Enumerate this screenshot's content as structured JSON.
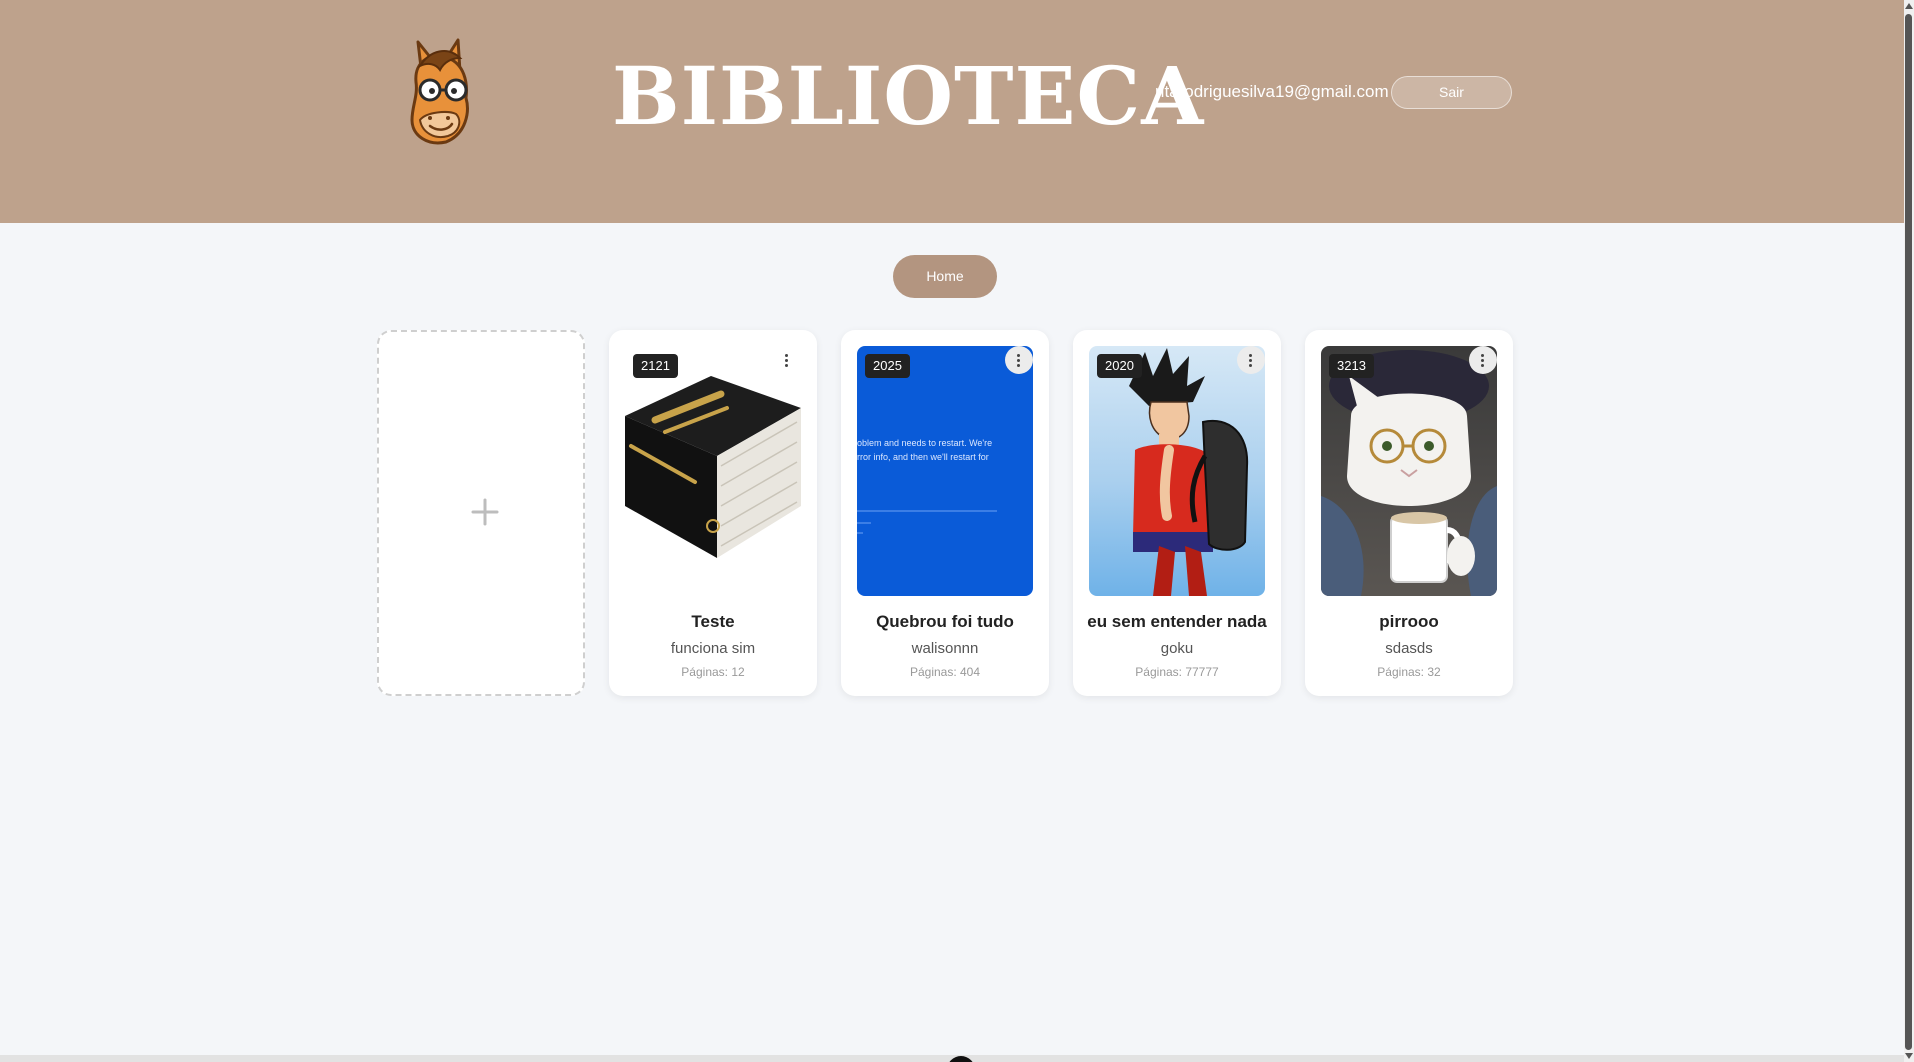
{
  "header": {
    "title": "BIBLIOTECA",
    "user_email": "ritarodriguesilva19@gmail.com",
    "logout_label": "Sair",
    "logo_icon": "horse-with-glasses-icon"
  },
  "nav": {
    "home_label": "Home"
  },
  "add_book": {
    "icon": "plus-icon"
  },
  "books": [
    {
      "year": "2121",
      "title": "Teste",
      "author": "funciona sim",
      "pages": "Páginas: 12",
      "cover": "black bible book cover"
    },
    {
      "year": "2025",
      "title": "Quebrou foi tudo",
      "author": "walisonnn",
      "pages": "Páginas: 404",
      "cover": "blue error screen",
      "cover_text_1": "oblem and needs to restart. We're",
      "cover_text_2": "rror info, and then we'll restart for"
    },
    {
      "year": "2020",
      "title": "eu sem entender nada",
      "author": "goku",
      "pages": "Páginas: 77777",
      "cover": "anime character with backpack"
    },
    {
      "year": "3213",
      "title": "pirrooo",
      "author": "sdasds",
      "pages": "Páginas: 32",
      "cover": "cat with glasses holding mug"
    }
  ],
  "colors": {
    "header_bg": "#bea28c",
    "page_bg": "#f4f6f9",
    "home_button": "#b39580",
    "badge_bg": "#222222"
  }
}
